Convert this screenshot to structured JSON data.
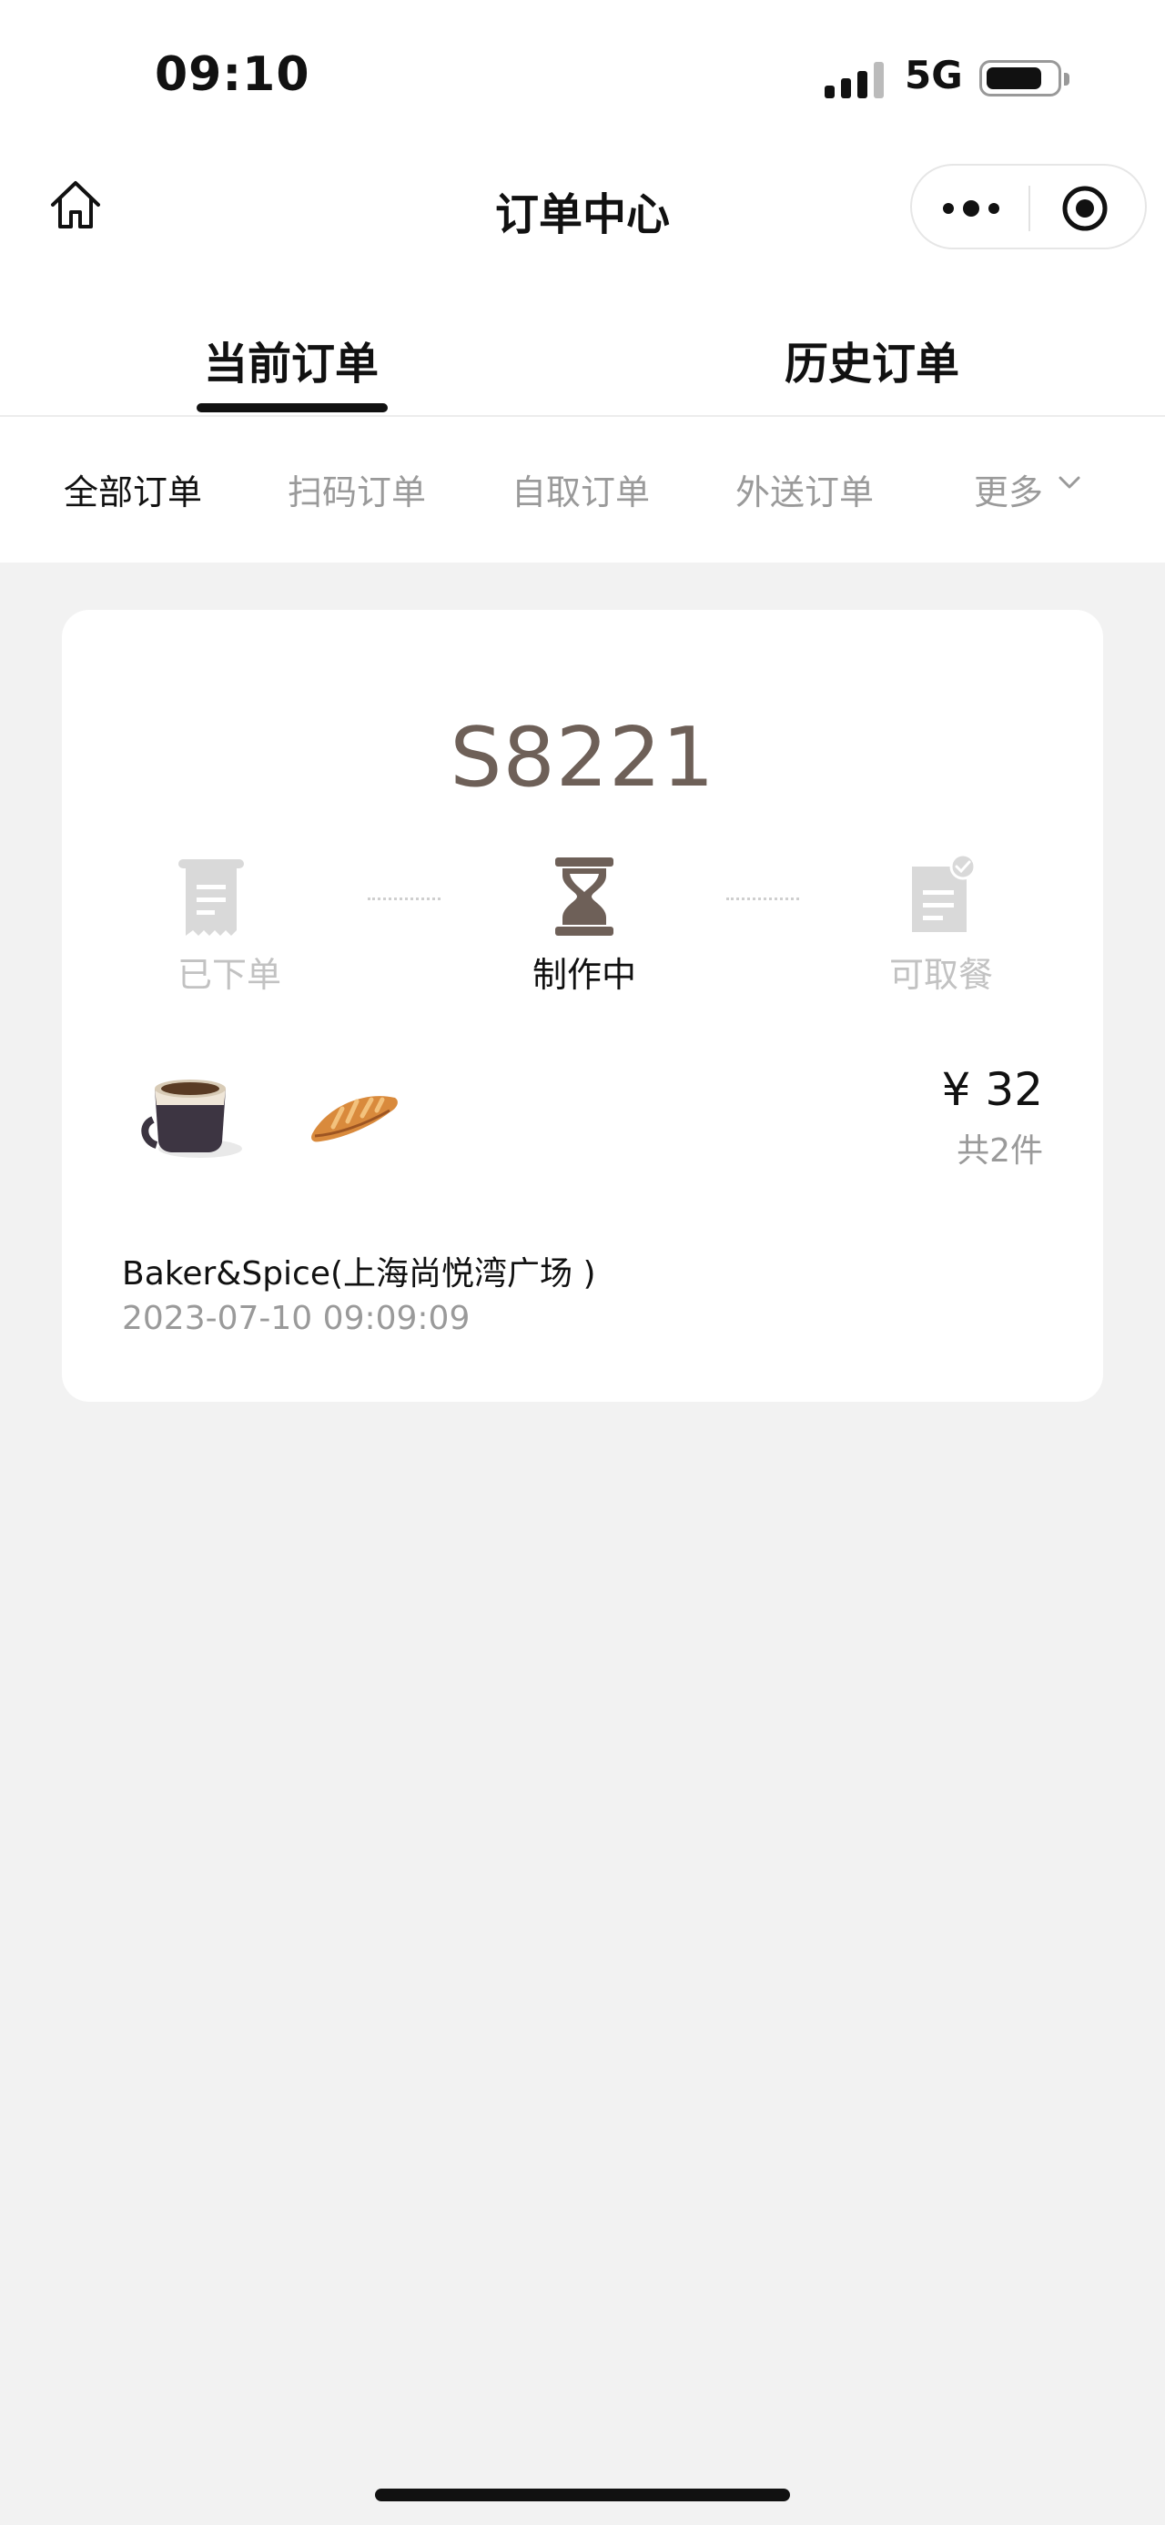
{
  "status_bar": {
    "time": "09:10",
    "network": "5G"
  },
  "nav": {
    "title": "订单中心"
  },
  "main_tabs": [
    {
      "label": "当前订单",
      "active": true
    },
    {
      "label": "历史订单",
      "active": false
    }
  ],
  "filters": [
    "全部订单",
    "扫码订单",
    "自取订单",
    "外送订单",
    "更多"
  ],
  "order": {
    "number": "S8221",
    "steps": [
      {
        "label": "已下单",
        "icon": "receipt-icon",
        "active": false
      },
      {
        "label": "制作中",
        "icon": "hourglass-icon",
        "active": true
      },
      {
        "label": "可取餐",
        "icon": "ready-doc-icon",
        "active": false
      }
    ],
    "items": [
      {
        "icon": "coffee-cup-image"
      },
      {
        "icon": "croissant-image"
      }
    ],
    "price": "¥ 32",
    "count": "共2件",
    "store": "Baker&Spice(上海尚悦湾广场 )",
    "datetime": "2023-07-10 09:09:09"
  },
  "colors": {
    "accent_brown": "#6e6058",
    "inactive": "#c2c2c2",
    "muted": "#9a9a9a"
  }
}
